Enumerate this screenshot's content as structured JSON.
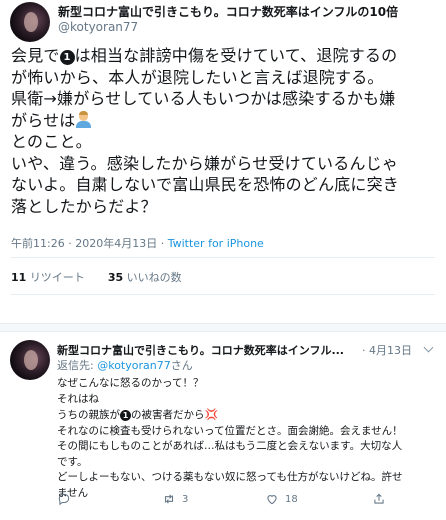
{
  "tweet": {
    "display_name": "新型コロナ富山で引きこもり。コロナ数死率はインフルの10倍",
    "handle": "@kotyoran77",
    "text_lines": [
      {
        "before": "会見で",
        "num": "1",
        "after": "は相当な誹謗中傷を受けていて、退院するの"
      },
      {
        "text": "が怖いから、本人が退院したいと言えば退院する。"
      },
      {
        "text": "県衛→嫌がらせしている人もいつかは感染するかも嫌"
      },
      {
        "text": "がらせは",
        "emoji": "person-shrugging-emoji"
      },
      {
        "text": "とのこと。"
      },
      {
        "text": "いや、違う。感染したから嫌がらせ受けているんじゃ"
      },
      {
        "text": "ないよ。自粛しないで富山県民を恐怖のどん底に突き"
      },
      {
        "text": "落としたからだよ？"
      }
    ],
    "time": "午前11:26",
    "date": "2020年4月13日",
    "source": "Twitter for iPhone",
    "retweets_count": "11",
    "retweets_label": "リツイート",
    "likes_count": "35",
    "likes_label": "いいねの数"
  },
  "reply": {
    "display_name": "新型コロナ富山で引きこもり。コロナ数死率はインフル...",
    "date": "4月13日",
    "replying_to_label": "返信先:",
    "replying_to_handle": "@kotyoran77",
    "replying_to_suffix": "さん",
    "lines": [
      {
        "text": "なぜこんなに怒るのかって！？"
      },
      {
        "text": "それはね"
      },
      {
        "before": "うちの親族が",
        "num": "1",
        "after": "の被害者だから",
        "spark": "💢"
      },
      {
        "text": "それなのに検査も受けられないって位置だとさ。面会謝絶。会えません！"
      },
      {
        "text": "その間にもしものことがあれば…私はもう二度と会えないます。大切な人"
      },
      {
        "text": "です。"
      },
      {
        "text": "どーしよーもない、つける薬もない奴に怒っても仕方がないけどね。許せ"
      },
      {
        "text": "ません"
      }
    ],
    "actions": {
      "reply_count": "",
      "retweet_count": "3",
      "like_count": "18"
    }
  },
  "icons": {
    "avatar": "avatar",
    "reply": "reply-icon",
    "retweet": "retweet-icon",
    "like": "heart-icon",
    "share": "share-icon",
    "menu": "chevron-down-icon"
  },
  "colors": {
    "text": "#14171a",
    "secondary": "#657786",
    "link": "#1b95e0",
    "divider": "#e6ecf0"
  }
}
